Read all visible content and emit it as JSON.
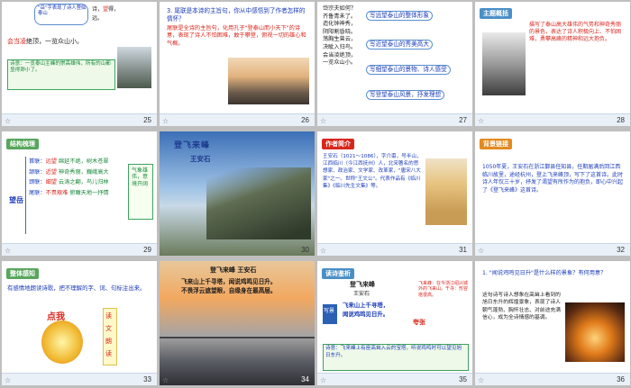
{
  "slides": [
    {
      "num": "25",
      "lines": [
        "\"岳\"字表现了诗人登临泰山",
        "等待的急切心",
        "中发起眺望的气概。"
      ],
      "l1a": "诗，",
      "l1b": "望",
      "l1c": "得，",
      "l1d": "远。",
      "bold": "会当凌",
      "rest": "绝顶，一览众山小。",
      "quote": "诗意：一览泰山主峰的",
      "quote2": "崇高雄伟，所有的山都",
      "quote3": "显得渺小了。"
    },
    {
      "num": "26",
      "q": "3. 尾联是本诗的主旨句，你从中感悟到了作者怎样的情怀？",
      "a": "尾联是全诗的主旨句，化用孔子\"登泰山而小天下\"的诗意，表现了诗人不怕困难，敢于攀登，俯视一切的雄心和气概。"
    },
    {
      "num": "27",
      "poem": [
        "岱宗夫如何？",
        "齐鲁青未了。",
        "造化钟神秀，",
        "阴阳割昏晓。",
        "荡胸生曾云，",
        "决眦入归鸟。",
        "会当凌绝顶，",
        "一览众山小。"
      ],
      "labels": [
        "写远望泰山的整体形象",
        "写近望泰山的秀美高大",
        "写细望泰山的景物、诗人感受",
        "写登望泰山风景，抒发理想"
      ],
      "hl": [
        "远",
        "近",
        "细",
        "登"
      ]
    },
    {
      "num": "28",
      "tag": "主题概括",
      "text": "描写了泰山高大雄伟的气势和神奇秀丽的景色，表达了诗人积极向上、不怕困难，勇攀高峰的精神和远大抱负。"
    },
    {
      "num": "29",
      "tag": "结构梳理",
      "side": "望岳",
      "rows": [
        {
          "h": "首联：",
          "k": "远望",
          "v": "绵延不绝，树木苍翠"
        },
        {
          "h": "颔联：",
          "k": "近望",
          "v": "神奇秀丽，巍峨高大"
        },
        {
          "h": "颈联：",
          "k": "细望",
          "v": "云涛之翻，鸟儿归林"
        },
        {
          "h": "尾联：",
          "k": "不畏艰难",
          "v": "俯瞰天地一抒情"
        }
      ],
      "right": "气象雄伟，意境开阔"
    },
    {
      "num": "30",
      "title": "登飞来峰",
      "author": "王安石"
    },
    {
      "num": "31",
      "tag": "作者简介",
      "text": "王安石（1021～1086），字介甫，号半山，江西临川（今江西抚州）人，北宋著名的思想家、政治家、文学家、改革家，\"唐宋八大家\"之一。世称\"王文公\"。代表作品有《临川集》《临川先生文集》等。"
    },
    {
      "num": "32",
      "tag": "背景链接",
      "text": "1050年夏，王安石在浙江鄞县任知县，任期届满后回江西临川故里，途经杭州，登上飞来峰顶，写下了这首诗。此时诗人年仅三十岁，抒发了渴望有所作为的抱负，即心中兴起了《登飞来峰》这首诗。"
    },
    {
      "num": "33",
      "tag": "整体感知",
      "text": "有感情地朗读诗歌，把不理解的字、词、句标注出来。",
      "btn": "点我",
      "side": [
        "读",
        "文",
        "朗",
        "读"
      ]
    },
    {
      "num": "34",
      "title": "登飞来峰  王安石",
      "lines": [
        "飞来山上千寻塔，闻说鸡鸣见日升。",
        "不畏浮云遮望眼，自缘身在最高层。"
      ]
    },
    {
      "num": "35",
      "tag": "读诗鉴析",
      "title": "登飞来峰",
      "author": "王安石",
      "lines": [
        "飞来山上千寻塔，",
        "闻说鸡鸣见日升。"
      ],
      "k1": "写景",
      "k2": "夸张",
      "note": "飞来峰：在今浙江绍兴城外的飞来山。千寻：形容塔很高。",
      "summary": "诗意：飞来峰上有座高耸入云的宝塔，听说鸡鸣时可以望见旭日东升。"
    },
    {
      "num": "36",
      "q": "1. \"闻说鸡鸣见日升\"是什么样的景象？有何用意？",
      "a": "这句诗写诗人想象在高耸上看到的旭日东升的辉煌景象，表现了诗人朝气蓬勃、胸怀壮志、对前途充满信心，成为全诗情感的基调。"
    }
  ]
}
